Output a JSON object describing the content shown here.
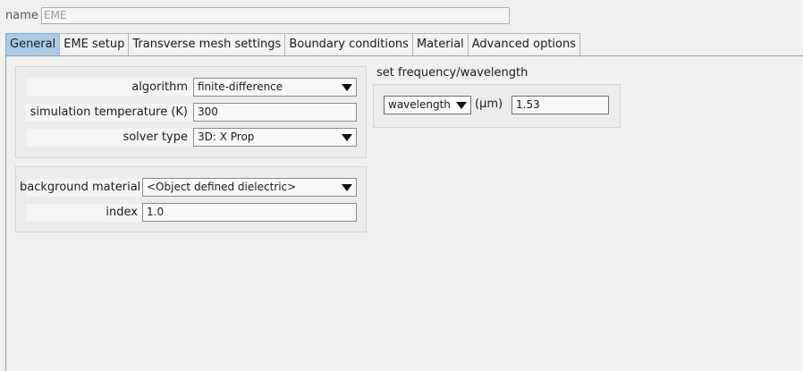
{
  "name_field": {
    "label": "name",
    "value": "EME"
  },
  "tabs": [
    {
      "label": "General",
      "active": true
    },
    {
      "label": "EME setup"
    },
    {
      "label": "Transverse mesh settings"
    },
    {
      "label": "Boundary conditions"
    },
    {
      "label": "Material"
    },
    {
      "label": "Advanced options"
    }
  ],
  "solver_panel": {
    "algorithm_label": "algorithm",
    "algorithm_value": "finite-difference",
    "temperature_label": "simulation temperature (K)",
    "temperature_value": "300",
    "solver_type_label": "solver type",
    "solver_type_value": "3D: X Prop"
  },
  "background_panel": {
    "material_label": "background material",
    "material_value": "<Object defined dielectric>",
    "index_label": "index",
    "index_value": "1.0"
  },
  "frequency_panel": {
    "title": "set frequency/wavelength",
    "mode_value": "wavelength",
    "unit": "(μm)",
    "value": "1.53"
  },
  "colors": {
    "active_tab": "#a9cbe7",
    "background": "#f0f0f0"
  }
}
